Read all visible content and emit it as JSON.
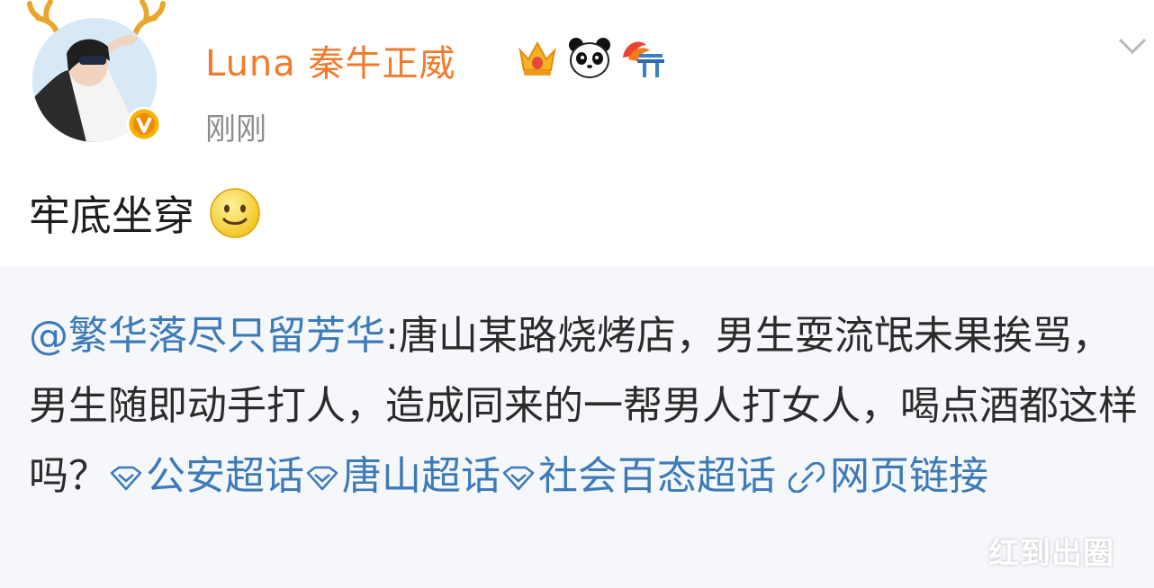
{
  "user": {
    "name": "Luna 秦牛正威",
    "timestamp": "刚刚",
    "badges": [
      "crown-badge-icon",
      "panda-badge-icon",
      "gate-badge-icon"
    ],
    "verified": true
  },
  "post": {
    "text": "牢底坐穿",
    "emoji": "smile-emoji-icon"
  },
  "repost": {
    "mention": "@繁华落尽只留芳华",
    "text": ":唐山某路烧烤店，男生耍流氓未果挨骂，男生随即动手打人，造成同来的一帮男人打女人，喝点酒都这样吗？",
    "topics": [
      "公安超话",
      "唐山超话",
      "社会百态超话"
    ],
    "link_label": "网页链接"
  },
  "watermark": "红到出圈",
  "colors": {
    "username": "#f07b2c",
    "link": "#3d7ab8",
    "repost_bg": "#f5f7fa",
    "timestamp": "#8c8c8c"
  }
}
